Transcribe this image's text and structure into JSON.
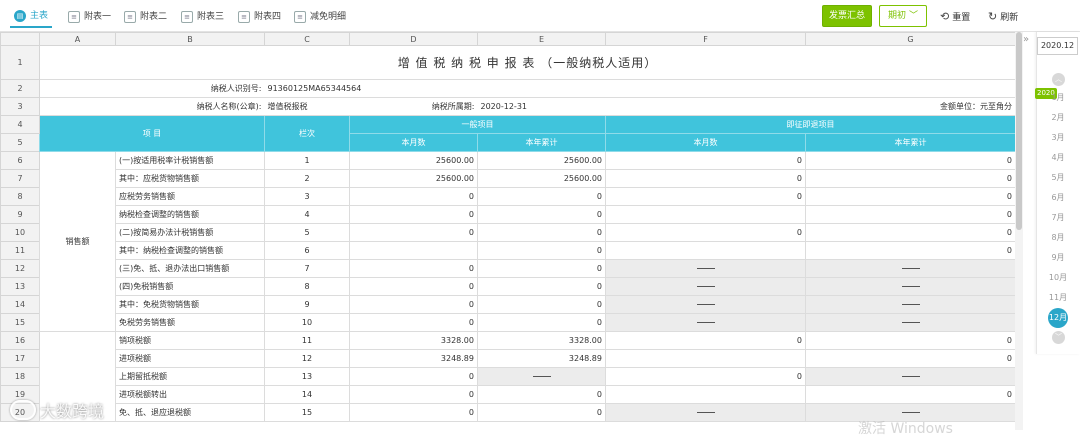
{
  "tabs": [
    {
      "label": "主表",
      "active": true
    },
    {
      "label": "附表一",
      "active": false
    },
    {
      "label": "附表二",
      "active": false
    },
    {
      "label": "附表三",
      "active": false
    },
    {
      "label": "附表四",
      "active": false
    },
    {
      "label": "减免明细",
      "active": false
    }
  ],
  "toolbar": {
    "invoice_summary": "发票汇总",
    "period": "期初",
    "reset": "重置",
    "refresh": "刷新"
  },
  "colors": {
    "accent": "#2aa6c9",
    "header_fill": "#40c4dc",
    "green": "#7dc200"
  },
  "columns": [
    "A",
    "B",
    "C",
    "D",
    "E",
    "F",
    "G"
  ],
  "sheet": {
    "title": "增 值 税 纳 税 申 报 表 （一般纳税人适用）",
    "taxpayer_id_label": "纳税人识别号:",
    "taxpayer_id": "91360125MA65344564",
    "taxpayer_name_label": "纳税人名称(公章):",
    "taxpayer_name": "增值税报税",
    "period_label": "纳税所属期:",
    "period_value": "2020-12-31",
    "unit": "金额单位：元至角分",
    "header_item": "项 目",
    "header_line": "栏次",
    "header_general": "一般项目",
    "header_refund": "即征即退项目",
    "header_month": "本月数",
    "header_ytd": "本年累计",
    "group_sales": "销售额"
  },
  "rows": [
    {
      "n": "6",
      "item": "(一)按适用税率计税销售额",
      "line": "1",
      "d": "25600.00",
      "e": "25600.00",
      "f": "0",
      "g": "0"
    },
    {
      "n": "7",
      "item": "其中：应税货物销售额",
      "line": "2",
      "d": "25600.00",
      "e": "25600.00",
      "f": "0",
      "g": "0"
    },
    {
      "n": "8",
      "item": "应税劳务销售额",
      "line": "3",
      "d": "0",
      "e": "0",
      "f": "0",
      "g": "0"
    },
    {
      "n": "9",
      "item": "纳税检查调整的销售额",
      "line": "4",
      "d": "0",
      "e": "0",
      "f": "",
      "g": "0"
    },
    {
      "n": "10",
      "item": "(二)按简易办法计税销售额",
      "line": "5",
      "d": "0",
      "e": "0",
      "f": "0",
      "g": "0"
    },
    {
      "n": "11",
      "item": "其中：纳税检查调整的销售额",
      "line": "6",
      "d": "",
      "e": "0",
      "f": "",
      "g": "0"
    },
    {
      "n": "12",
      "item": "(三)免、抵、退办法出口销售额",
      "line": "7",
      "d": "0",
      "e": "0",
      "f": "—",
      "g": "—"
    },
    {
      "n": "13",
      "item": "(四)免税销售额",
      "line": "8",
      "d": "0",
      "e": "0",
      "f": "—",
      "g": "—"
    },
    {
      "n": "14",
      "item": "其中：免税货物销售额",
      "line": "9",
      "d": "0",
      "e": "0",
      "f": "—",
      "g": "—"
    },
    {
      "n": "15",
      "item": "免税劳务销售额",
      "line": "10",
      "d": "0",
      "e": "0",
      "f": "—",
      "g": "—"
    },
    {
      "n": "16",
      "item": "销项税额",
      "line": "11",
      "d": "3328.00",
      "e": "3328.00",
      "f": "0",
      "g": "0"
    },
    {
      "n": "17",
      "item": "进项税额",
      "line": "12",
      "d": "3248.89",
      "e": "3248.89",
      "f": "",
      "g": "0"
    },
    {
      "n": "18",
      "item": "上期留抵税额",
      "line": "13",
      "d": "0",
      "e": "—",
      "f": "0",
      "g": "—"
    },
    {
      "n": "19",
      "item": "进项税额转出",
      "line": "14",
      "d": "0",
      "e": "0",
      "f": "",
      "g": "0"
    },
    {
      "n": "20",
      "item": "免、抵、退应退税额",
      "line": "15",
      "d": "0",
      "e": "0",
      "f": "—",
      "g": "—"
    }
  ],
  "timeline": {
    "current": "2020.12",
    "year": "2020",
    "months": [
      "1月",
      "2月",
      "3月",
      "4月",
      "5月",
      "6月",
      "7月",
      "8月",
      "9月",
      "10月",
      "11月",
      "12月"
    ],
    "selected_month": "12月"
  },
  "watermark": "大数跨境",
  "activate_notice": "激活 Windows"
}
